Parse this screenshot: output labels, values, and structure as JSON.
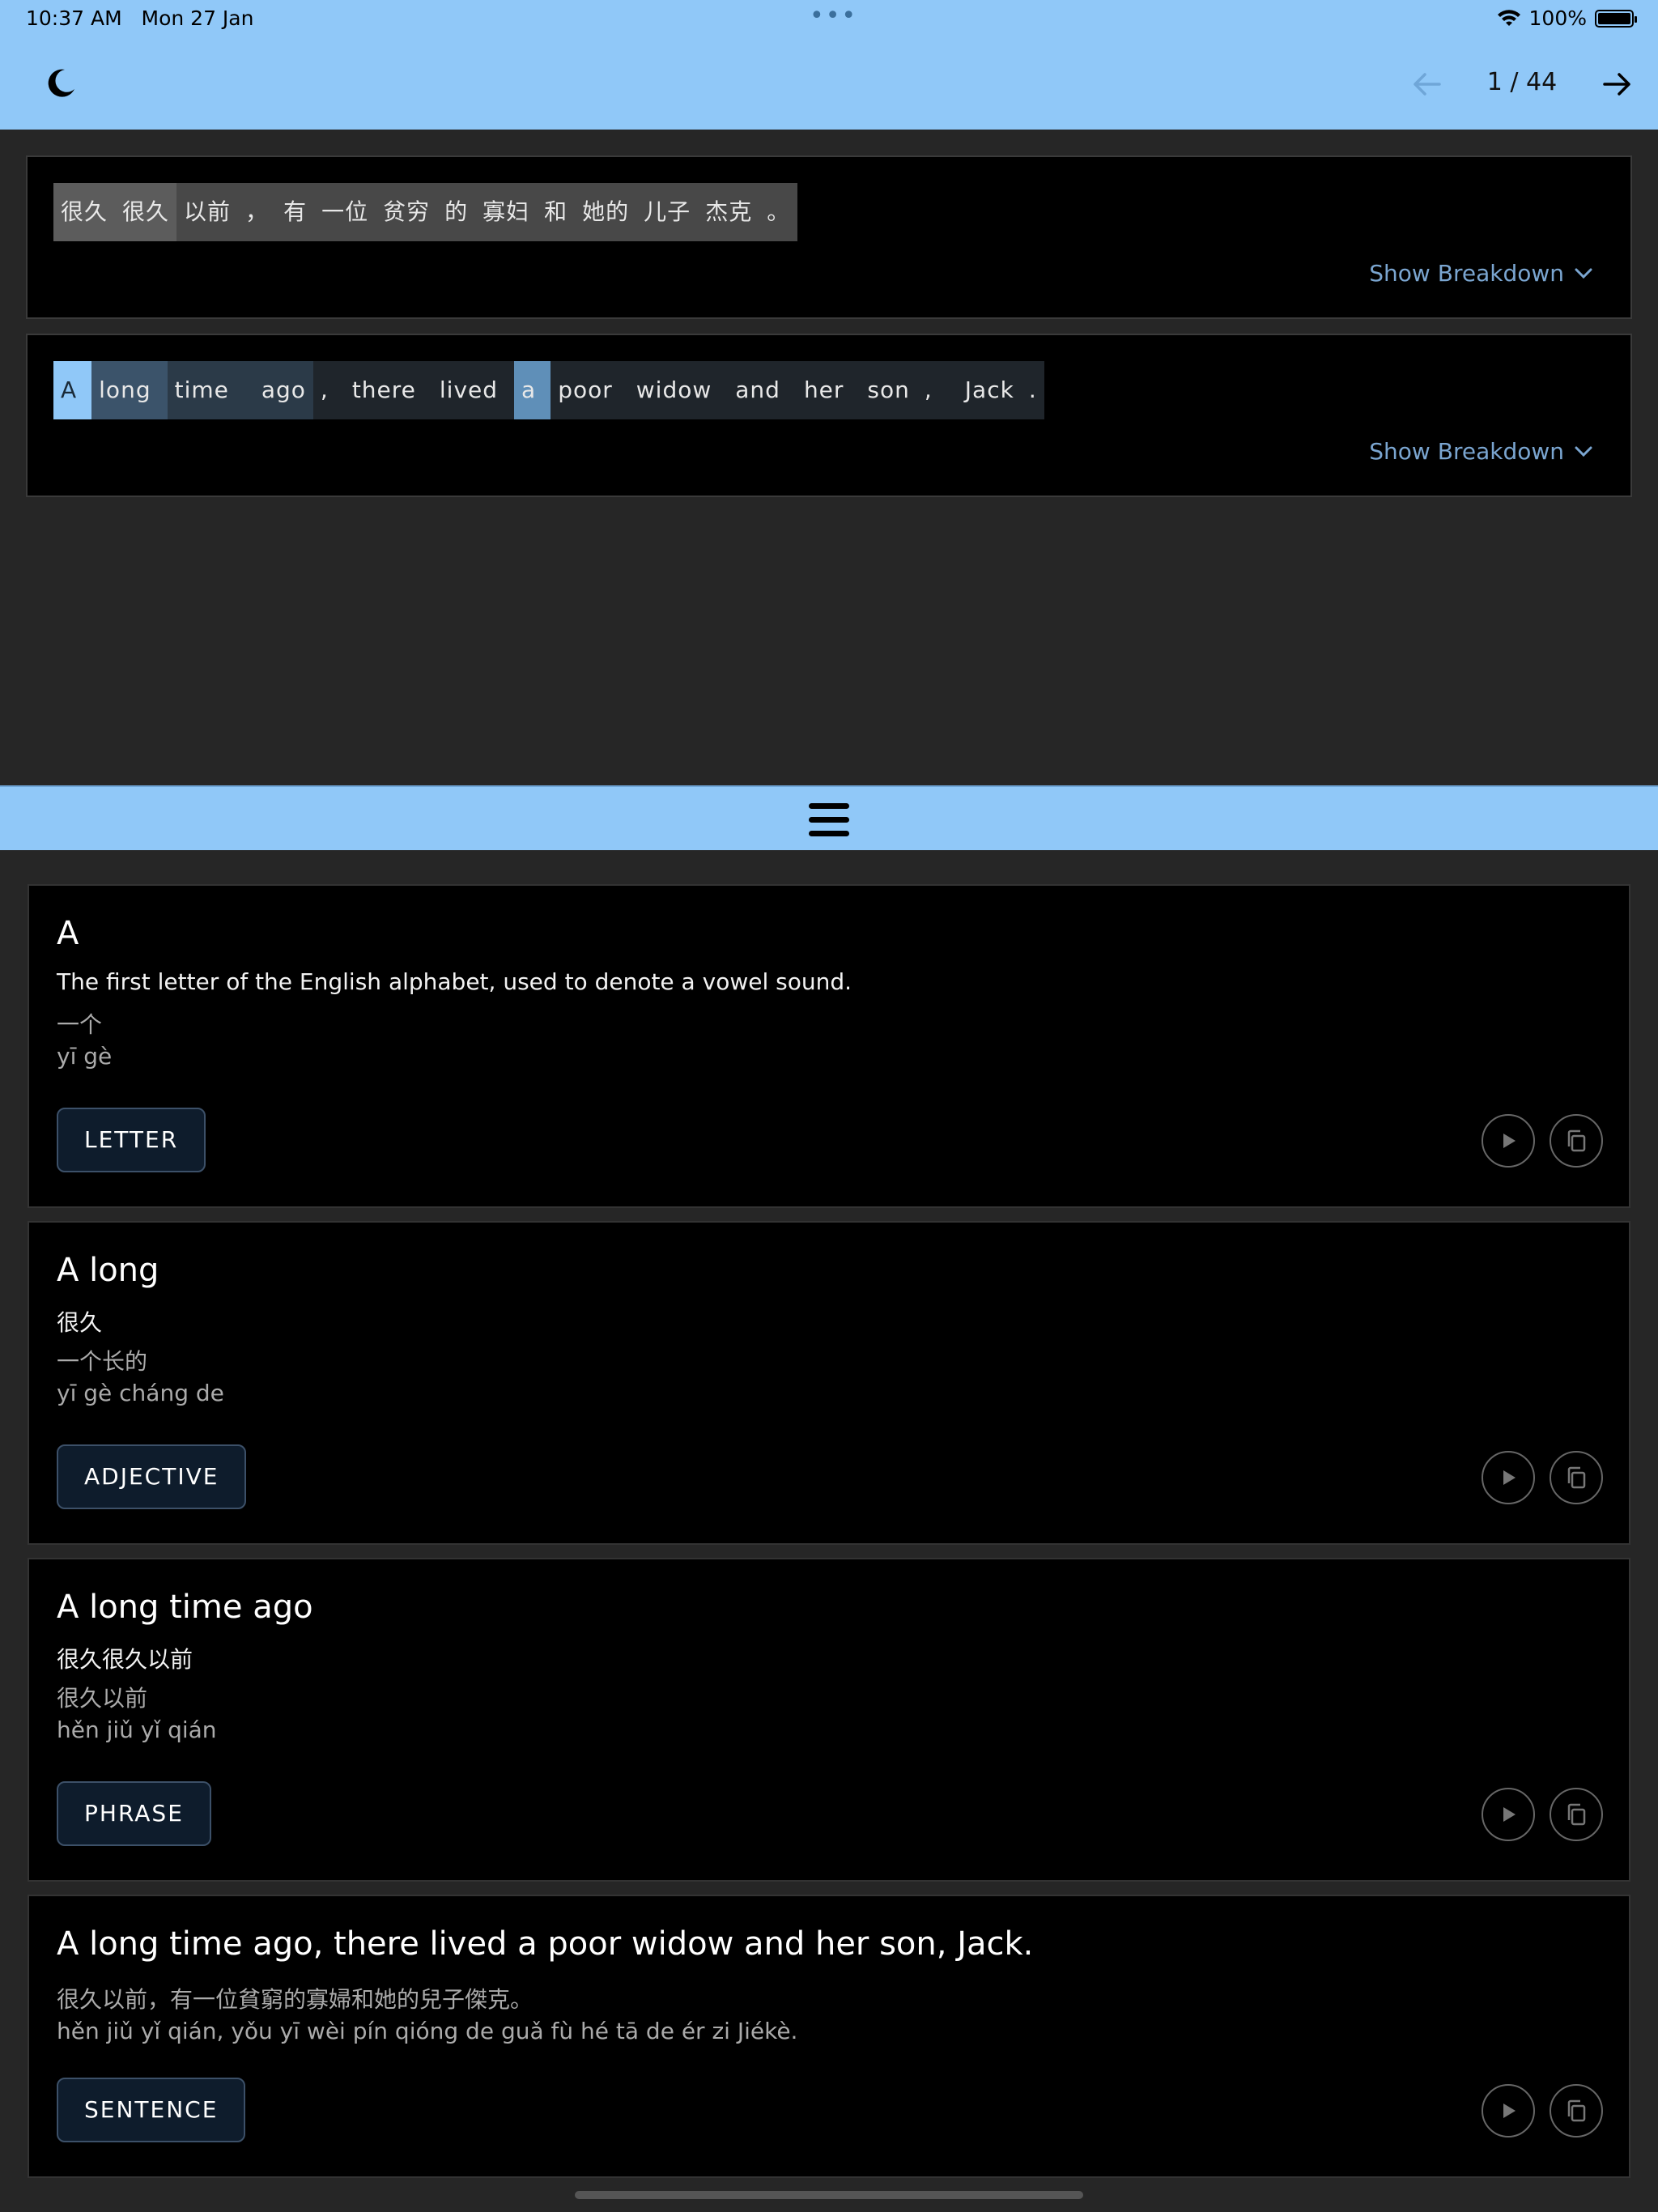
{
  "status_bar": {
    "time": "10:37 AM",
    "date": "Mon 27 Jan",
    "dots": "•••",
    "battery_pct": "100%"
  },
  "header": {
    "theme_icon": "moon-icon",
    "prev_icon": "arrow-left-icon",
    "next_icon": "arrow-right-icon",
    "page_counter": "1 / 44"
  },
  "sentence_zh": {
    "tokens": [
      "很久",
      "很久",
      "以前",
      "，",
      "有",
      "一位",
      "贫穷",
      "的",
      "寡妇",
      "和",
      "她的",
      "儿子",
      "杰克",
      "。"
    ],
    "breakdown_label": "Show Breakdown"
  },
  "sentence_en": {
    "tokens": [
      "A",
      "long",
      "time",
      "ago",
      ",",
      "there",
      "lived",
      "a",
      "poor",
      "widow",
      "and",
      "her",
      "son",
      ",",
      "Jack",
      "."
    ],
    "breakdown_label": "Show Breakdown"
  },
  "splitter": {
    "icon": "hamburger-icon"
  },
  "cards": [
    {
      "title": "A",
      "line1": "The first letter of the English alphabet, used to denote a vowel sound.",
      "line2": "一个",
      "line3": "yī gè",
      "pos": "LETTER"
    },
    {
      "title": "A long",
      "line1": "很久",
      "line2": "一个长的",
      "line3": "yī gè cháng de",
      "pos": "ADJECTIVE"
    },
    {
      "title": "A long time ago",
      "line1": "很久很久以前",
      "line2": "很久以前",
      "line3": "hěn jiǔ yǐ qián",
      "pos": "PHRASE"
    },
    {
      "title": "A long time ago, there lived a poor widow and her son, Jack.",
      "line1": "很久以前，有一位貧窮的寡婦和她的兒子傑克。",
      "line2": "hěn jiǔ yǐ qián, yǒu yī wèi pín qióng de guǎ fù hé tā de ér zi Jiékè.",
      "pos": "SENTENCE"
    }
  ],
  "colors": {
    "accent": "#90c8f8",
    "background": "#262626",
    "card": "#000000",
    "link": "#7aa5d0"
  }
}
